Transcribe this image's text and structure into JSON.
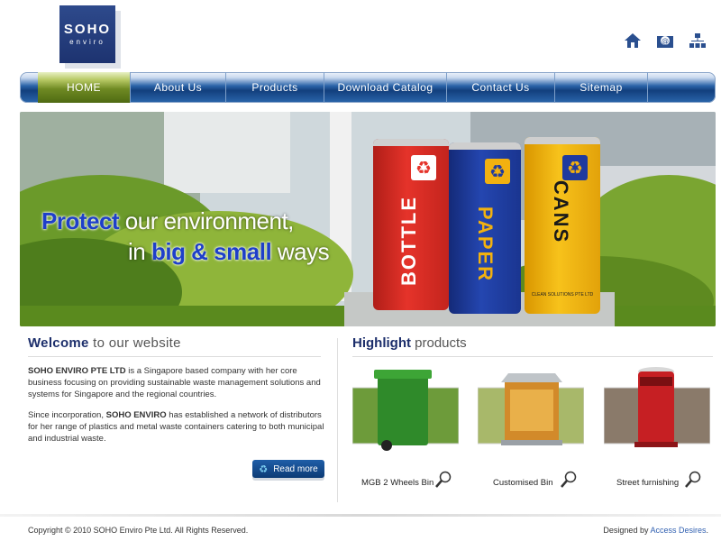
{
  "brand": {
    "logo_line1": "SOHO",
    "logo_line2": "enviro"
  },
  "top_icons": [
    "home-icon",
    "email-icon",
    "sitemap-icon"
  ],
  "nav": {
    "items": [
      {
        "label": "HOME",
        "active": true
      },
      {
        "label": "About Us"
      },
      {
        "label": "Products"
      },
      {
        "label": "Download Catalog"
      },
      {
        "label": "Contact Us"
      },
      {
        "label": "Sitemap"
      }
    ]
  },
  "hero": {
    "line1_bold": "Protect",
    "line1_rest": " our environment,",
    "line2_pre": "in ",
    "line2_bold": "big & small",
    "line2_rest": " ways",
    "bins": [
      {
        "label": "BOTTLE",
        "color": "#e5332a"
      },
      {
        "label": "PAPER",
        "color": "#1f3a9e"
      },
      {
        "label": "CANS",
        "color": "#f2b10f"
      }
    ],
    "bin_caption": "CLEAN SOLUTIONS PTE LTD"
  },
  "welcome": {
    "title_bold": "Welcome",
    "title_rest": " to our website",
    "para1_bold": "SOHO ENVIRO PTE LTD",
    "para1_rest": " is a Singapore based company with her core business focusing on providing sustainable waste management solutions and systems for Singapore and the regional countries.",
    "para2_pre": "Since incorporation, ",
    "para2_bold": "SOHO ENVIRO",
    "para2_rest": " has established a network of distributors for her range of plastics and metal waste containers catering to both municipal and industrial waste.",
    "read_more": "Read more"
  },
  "highlight": {
    "title_bold": "Highlight",
    "title_rest": " products",
    "products": [
      {
        "label": "MGB 2 Wheels Bin"
      },
      {
        "label": "Customised Bin"
      },
      {
        "label": "Street furnishing"
      }
    ]
  },
  "footer": {
    "copyright": "Copyright © 2010 SOHO Enviro Pte Ltd. All Rights Reserved.",
    "designed_by": "Designed by ",
    "designer": "Access Desires",
    "period": "."
  },
  "colors": {
    "navy": "#1c2e6b",
    "nav_blue": "#123f7d",
    "active_green": "#6f8a23"
  }
}
